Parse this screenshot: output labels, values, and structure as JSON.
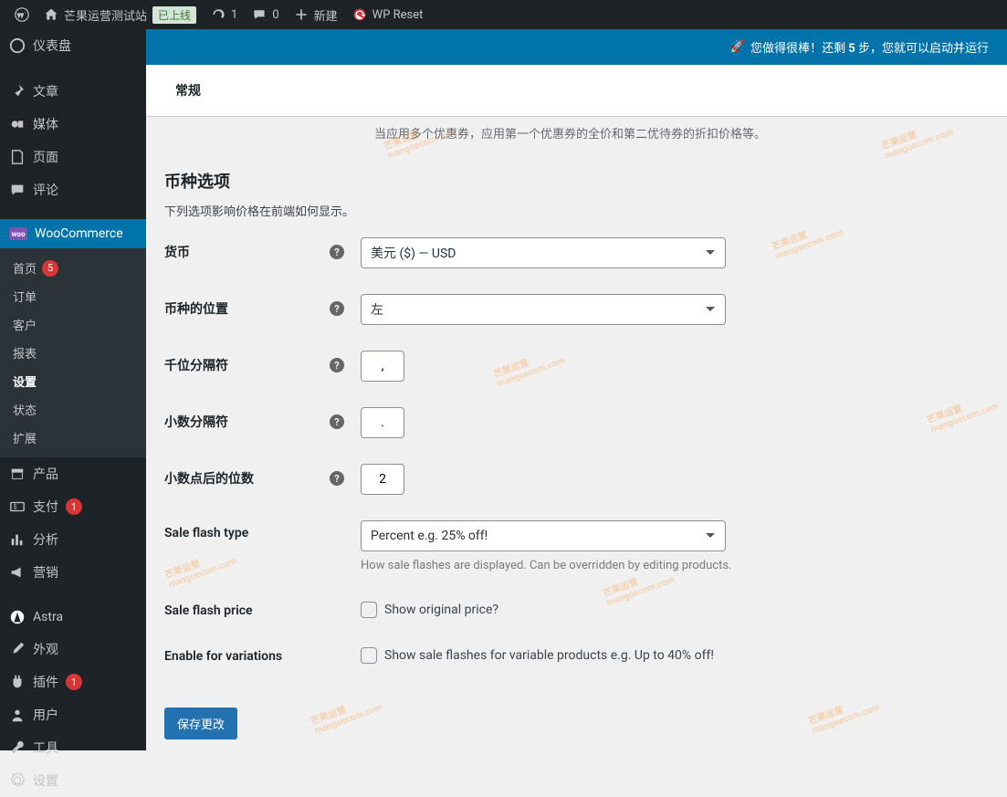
{
  "adminbar": {
    "site_name": "芒果运营测试站",
    "live_badge": "已上线",
    "update_count": "1",
    "comment_count": "0",
    "new_label": "新建",
    "wp_reset": "WP Reset"
  },
  "banner": {
    "rocket": "🚀",
    "text_prefix": "您做得很棒！还剩 ",
    "steps": "5",
    "text_suffix": " 步，您就可以启动并运行"
  },
  "sidebar": {
    "dashboard": "仪表盘",
    "posts": "文章",
    "media": "媒体",
    "pages": "页面",
    "comments": "评论",
    "woocommerce": "WooCommerce",
    "submenu": {
      "home": "首页",
      "home_badge": "5",
      "orders": "订单",
      "customers": "客户",
      "reports": "报表",
      "settings": "设置",
      "status": "状态",
      "extensions": "扩展"
    },
    "products": "产品",
    "payments": "支付",
    "payments_badge": "1",
    "analytics": "分析",
    "marketing": "营销",
    "astra": "Astra",
    "appearance": "外观",
    "plugins": "插件",
    "plugins_badge": "1",
    "users": "用户",
    "tools": "工具",
    "settings_bottom": "设置"
  },
  "tab": {
    "general": "常规"
  },
  "main": {
    "top_hint": "当应用多个优惠券，应用第一个优惠券的全价和第二优待券的折扣价格等。",
    "currency_options_heading": "币种选项",
    "currency_options_desc": "下列选项影响价格在前端如何显示。",
    "currency_label": "货币",
    "currency_value": "美元 ($) — USD",
    "position_label": "币种的位置",
    "position_value": "左",
    "thousand_label": "千位分隔符",
    "thousand_value": ",",
    "decimal_label": "小数分隔符",
    "decimal_value": ".",
    "num_decimals_label": "小数点后的位数",
    "num_decimals_value": "2",
    "sale_flash_label": "Sale flash type",
    "sale_flash_value": "Percent e.g. 25% off!",
    "sale_flash_desc": "How sale flashes are displayed. Can be overridden by editing products.",
    "sale_flash_price_label": "Sale flash price",
    "sale_flash_price_checkbox": "Show original price?",
    "enable_var_label": "Enable for variations",
    "enable_var_checkbox": "Show sale flashes for variable products e.g. Up to 40% off!",
    "save_button": "保存更改"
  },
  "watermark": {
    "text": "芒果运营",
    "url": "mangoecom.com"
  }
}
